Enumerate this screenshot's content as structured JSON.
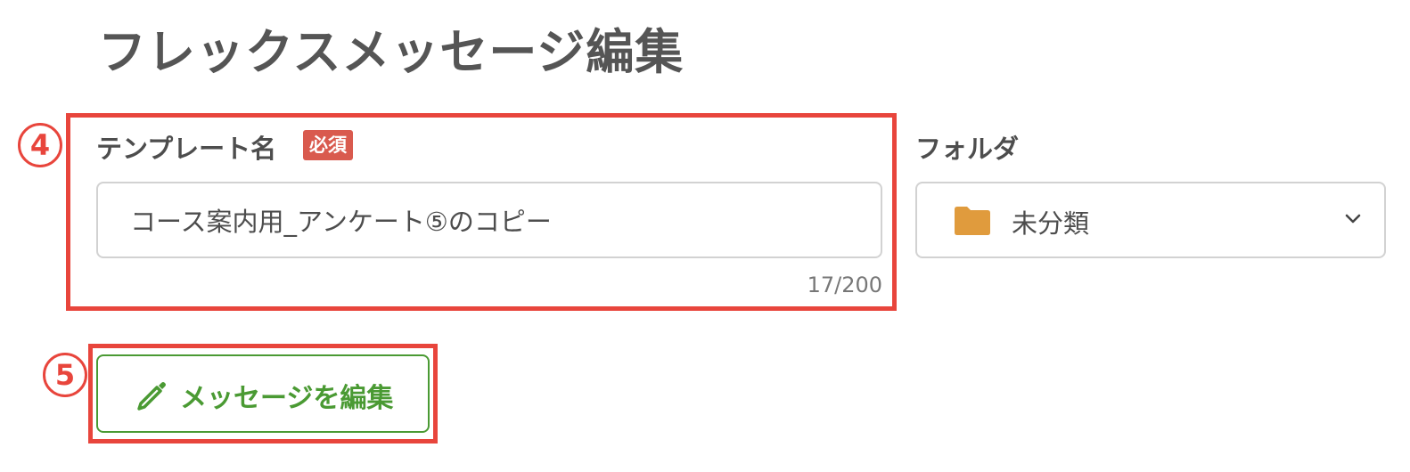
{
  "header": {
    "title": "フレックスメッセージ編集"
  },
  "annotations": {
    "step_a": "4",
    "step_b": "5"
  },
  "template_name": {
    "label": "テンプレート名",
    "required_badge": "必須",
    "value": "コース案内用_アンケート⑤のコピー",
    "counter": "17/200"
  },
  "folder": {
    "label": "フォルダ",
    "selected": "未分類",
    "icon": "folder-icon",
    "icon_color": "#e09b3d"
  },
  "actions": {
    "edit_message_label": "メッセージを編集",
    "icon": "pencil-icon"
  },
  "colors": {
    "annotation": "#e8453c",
    "required": "#d95a4e",
    "primary_green": "#4a9a33"
  }
}
